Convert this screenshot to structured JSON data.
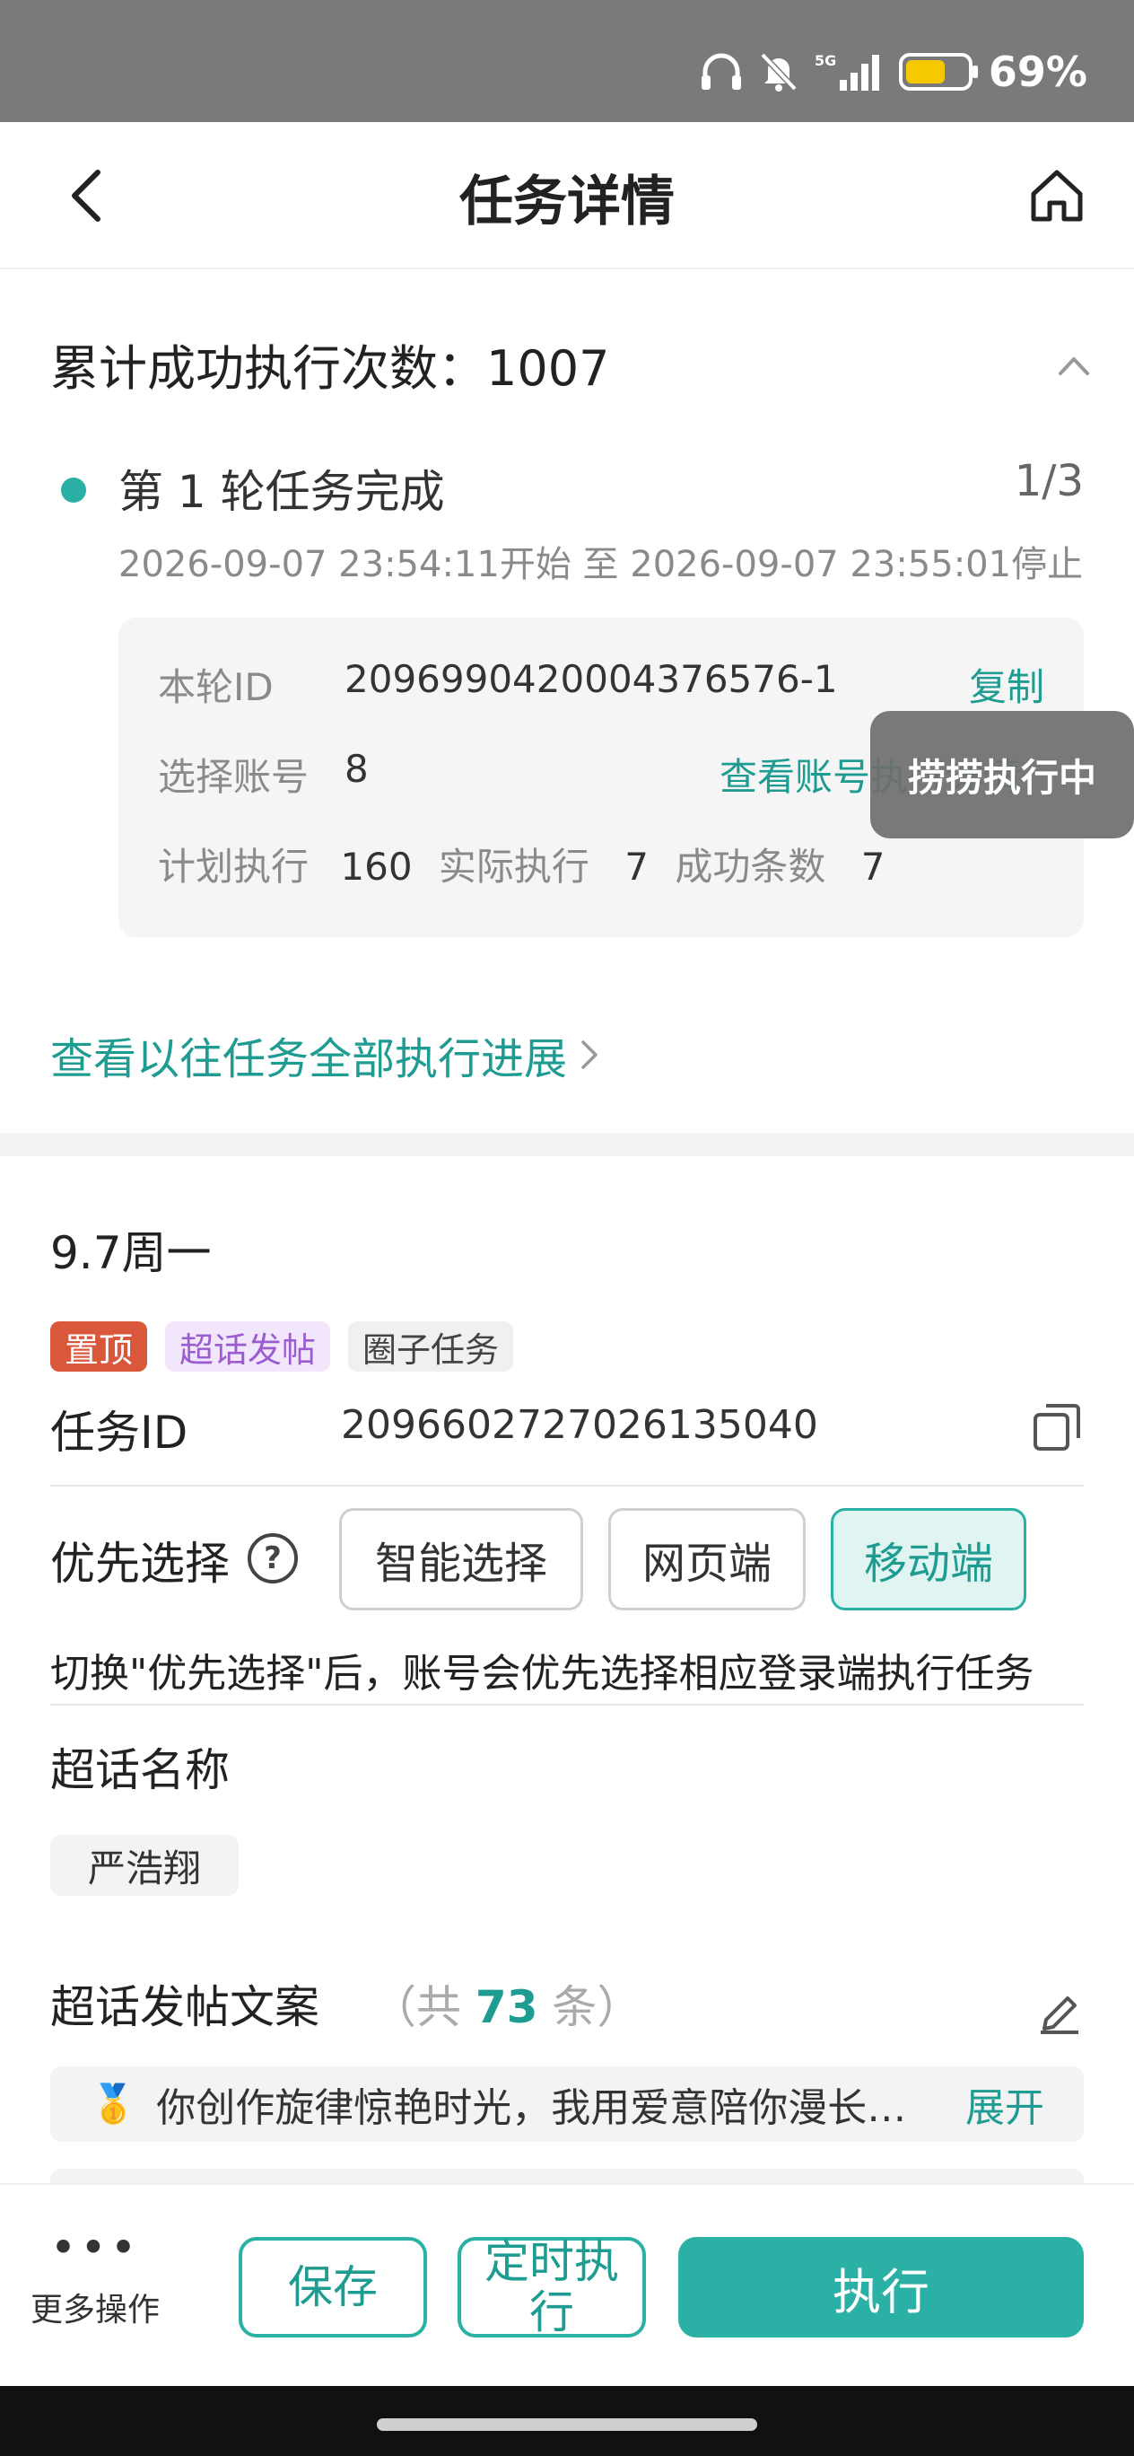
{
  "status_bar": {
    "battery_percent": "69%",
    "network": "5G"
  },
  "header": {
    "title": "任务详情"
  },
  "summary": {
    "count_label": "累计成功执行次数：1007",
    "round": {
      "title": "第 1 轮任务完成",
      "fraction": "1/3",
      "time": "2026-09-07 23:54:11开始 至 2026-09-07 23:55:01停止",
      "id_label": "本轮ID",
      "id_value": "20969904200043765​76-1",
      "copy_label": "复制",
      "accounts_label": "选择账号",
      "accounts_value": "8",
      "view_accounts_label": "查看账号执行详情",
      "plan_label": "计划执行",
      "plan_value": "160",
      "actual_label": "实际执行",
      "actual_value": "7",
      "success_label": "成功条数",
      "success_value": "7"
    },
    "toast": "捞捞执行中",
    "history_link": "查看以往任务全部执行进展"
  },
  "detail": {
    "date": "9.7周一",
    "tags": [
      "置顶",
      "超话发帖",
      "圈子任务"
    ],
    "task_id_label": "任务ID",
    "task_id_value": "2096602727026135040",
    "priority_label": "优先选择",
    "options": [
      "智能选择",
      "网页端",
      "移动端"
    ],
    "selected_option": "移动端",
    "hint": "切换\"优先选择\"后，账号会优先选择相应登录端执行任务",
    "topic_name_label": "超话名称",
    "topic_name_value": "严浩翔",
    "copy_label": "超话发帖文案",
    "copy_count_prefix": "（共",
    "copy_count": "73",
    "copy_count_suffix": "条）",
    "copy_item_text": "你创作旋律惊艳时光，我用爱意陪你漫长…",
    "expand_label": "展开"
  },
  "bottom_bar": {
    "more_label": "更多操作",
    "save_label": "保存",
    "schedule_label": "定时执行",
    "execute_label": "执行"
  },
  "colors": {
    "accent": "#2bb0a5",
    "tag_top": "#d9573b",
    "tag_super": "#9b5cd0"
  }
}
